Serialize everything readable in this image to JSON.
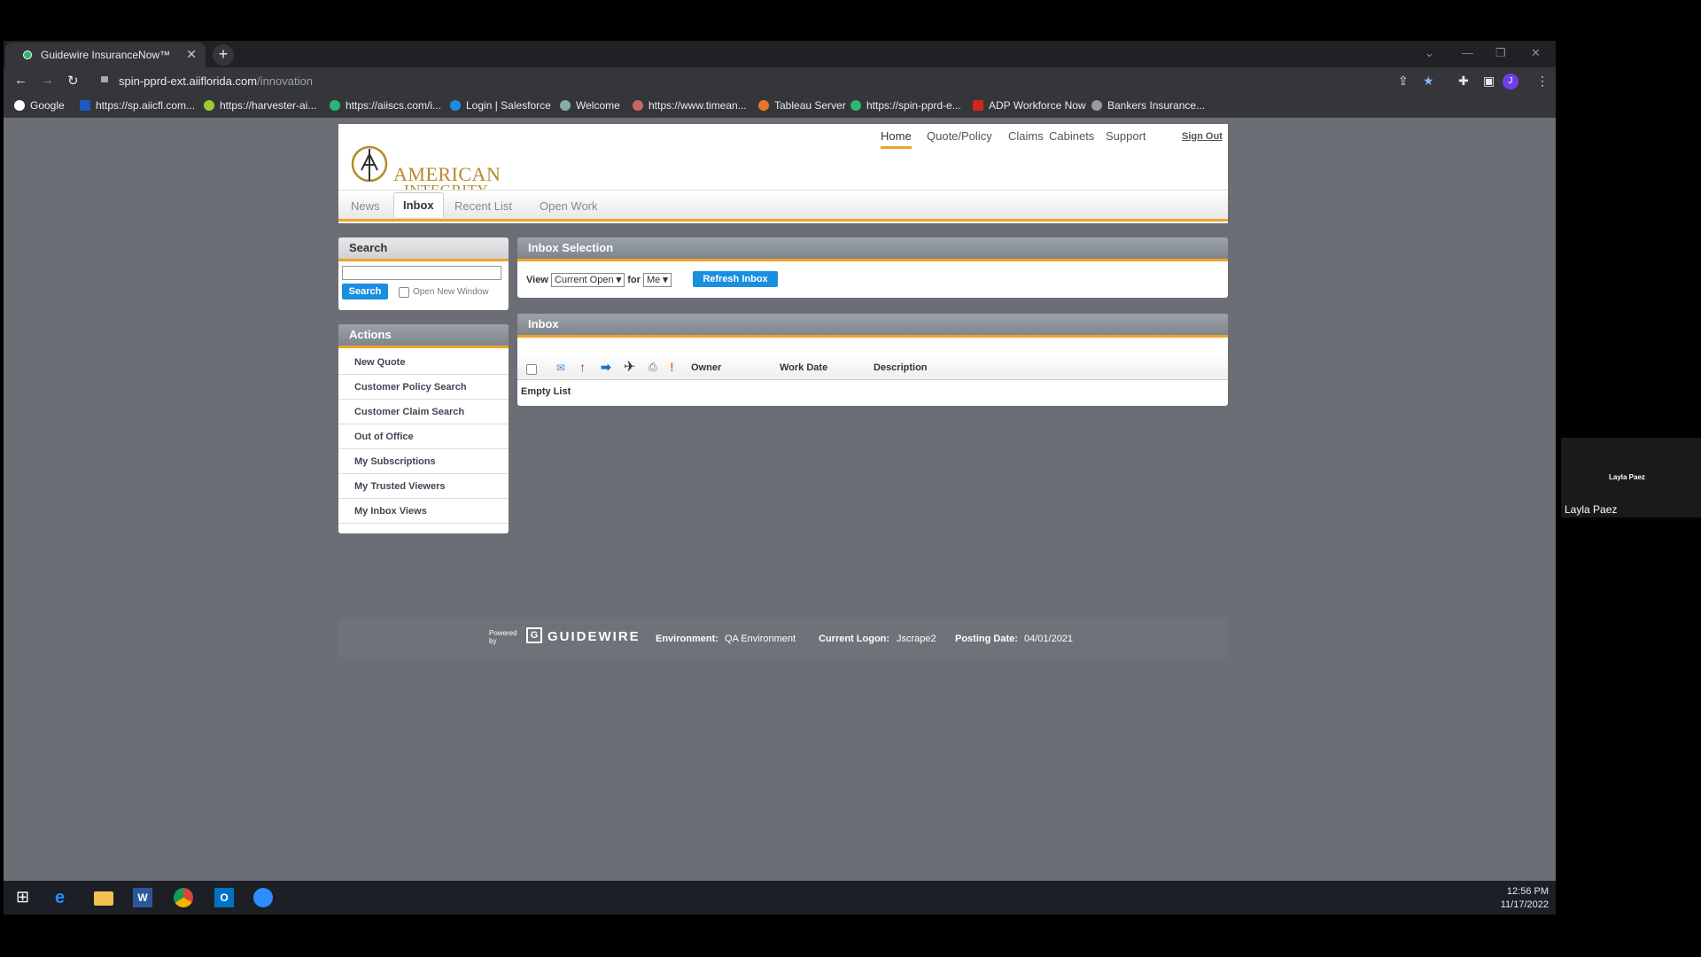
{
  "browser": {
    "tab_title": "Guidewire InsuranceNow™",
    "url_host": "spin-pprd-ext.aiiflorida.com",
    "url_path": "/innovation",
    "bookmarks": [
      "Google",
      "https://sp.aiicfl.com...",
      "https://harvester-ai...",
      "https://aiiscs.com/i...",
      "Login | Salesforce",
      "Welcome",
      "https://www.timean...",
      "Tableau Server",
      "https://spin-pprd-e...",
      "ADP Workforce Now",
      "Bankers Insurance..."
    ],
    "profile_initial": "J"
  },
  "header": {
    "logo_text_line1": "AMERICAN",
    "logo_text_line2": "INTEGRITY",
    "topnav": [
      "Home",
      "Quote/Policy",
      "Claims",
      "Cabinets",
      "Support"
    ],
    "sign_out": "Sign Out",
    "subtabs": [
      "News",
      "Inbox",
      "Recent List",
      "Open Work"
    ]
  },
  "search": {
    "title": "Search",
    "button": "Search",
    "open_new_window": "Open New Window"
  },
  "actions": {
    "title": "Actions",
    "items": [
      "New Quote",
      "Customer Policy Search",
      "Customer Claim Search",
      "Out of Office",
      "My Subscriptions",
      "My Trusted Viewers",
      "My Inbox Views"
    ]
  },
  "inbox_selection": {
    "title": "Inbox Selection",
    "view_label": "View",
    "view_value": "Current Open",
    "for_label": "for",
    "for_value": "Me",
    "refresh": "Refresh Inbox"
  },
  "inbox": {
    "title": "Inbox",
    "columns": [
      "Owner",
      "Work Date",
      "Description"
    ],
    "empty": "Empty List"
  },
  "footer": {
    "powered_by": "Powered by",
    "brand": "GUIDEWIRE",
    "env_label": "Environment:",
    "env_value": "QA Environment",
    "logon_label": "Current Logon:",
    "logon_value": "Jscrape2",
    "posting_label": "Posting Date:",
    "posting_value": "04/01/2021"
  },
  "taskbar": {
    "time": "12:56 PM",
    "date": "11/17/2022"
  },
  "video": {
    "name_small": "Layla Paez",
    "name": "Layla Paez"
  }
}
